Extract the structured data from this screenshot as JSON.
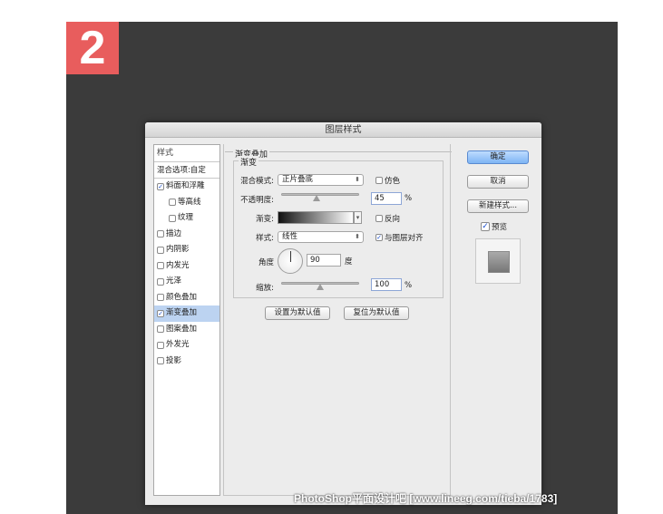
{
  "badge": {
    "number": "2"
  },
  "dialog": {
    "title": "图层样式",
    "styles_header": "样式",
    "blend_options": "混合选项:自定",
    "style_items": [
      {
        "label": "斜面和浮雕",
        "checked": true,
        "sub": false,
        "selected": false
      },
      {
        "label": "等高线",
        "checked": false,
        "sub": true,
        "selected": false
      },
      {
        "label": "纹理",
        "checked": false,
        "sub": true,
        "selected": false
      },
      {
        "label": "描边",
        "checked": false,
        "sub": false,
        "selected": false
      },
      {
        "label": "内阴影",
        "checked": false,
        "sub": false,
        "selected": false
      },
      {
        "label": "内发光",
        "checked": false,
        "sub": false,
        "selected": false
      },
      {
        "label": "光泽",
        "checked": false,
        "sub": false,
        "selected": false
      },
      {
        "label": "颜色叠加",
        "checked": false,
        "sub": false,
        "selected": false
      },
      {
        "label": "渐变叠加",
        "checked": true,
        "sub": false,
        "selected": true
      },
      {
        "label": "图案叠加",
        "checked": false,
        "sub": false,
        "selected": false
      },
      {
        "label": "外发光",
        "checked": false,
        "sub": false,
        "selected": false
      },
      {
        "label": "投影",
        "checked": false,
        "sub": false,
        "selected": false
      }
    ],
    "panel": {
      "group_title": "渐变叠加",
      "sub_title": "渐变",
      "blend_mode_label": "混合模式:",
      "blend_mode_value": "正片叠底",
      "dither_label": "仿色",
      "opacity_label": "不透明度:",
      "opacity_value": "45",
      "opacity_fraction": 0.45,
      "percent": "%",
      "gradient_label": "渐变:",
      "reverse_label": "反向",
      "style_label": "样式:",
      "style_value": "线性",
      "align_label": "与图层对齐",
      "align_checked": true,
      "angle_label": "角度",
      "angle_value": "90",
      "degree_unit": "度",
      "scale_label": "缩放:",
      "scale_value": "100",
      "scale_fraction": 0.5,
      "set_default": "设置为默认值",
      "reset_default": "复位为默认值"
    },
    "buttons": {
      "ok": "确定",
      "cancel": "取消",
      "new_style": "新建样式...",
      "preview": "预览"
    }
  },
  "watermark": "PhotoShop平面设计吧 [www.lineeg.com/tieba/1783]"
}
